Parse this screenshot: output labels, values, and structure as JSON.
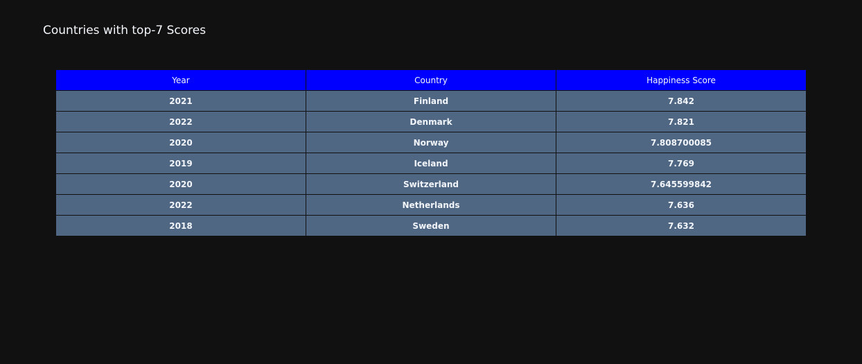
{
  "chart_data": {
    "type": "table",
    "title": "Countries with top-7 Scores",
    "columns": [
      "Year",
      "Country",
      "Happiness Score"
    ],
    "rows": [
      [
        "2021",
        "Finland",
        "7.842"
      ],
      [
        "2022",
        "Denmark",
        "7.821"
      ],
      [
        "2020",
        "Norway",
        "7.808700085"
      ],
      [
        "2019",
        "Iceland",
        "7.769"
      ],
      [
        "2020",
        "Switzerland",
        "7.645599842"
      ],
      [
        "2022",
        "Netherlands",
        "7.636"
      ],
      [
        "2018",
        "Sweden",
        "7.632"
      ]
    ],
    "colors": {
      "background": "#111111",
      "header_fill": "#0000ff",
      "cell_fill": "#506784",
      "text": "#f2f5fa"
    }
  }
}
